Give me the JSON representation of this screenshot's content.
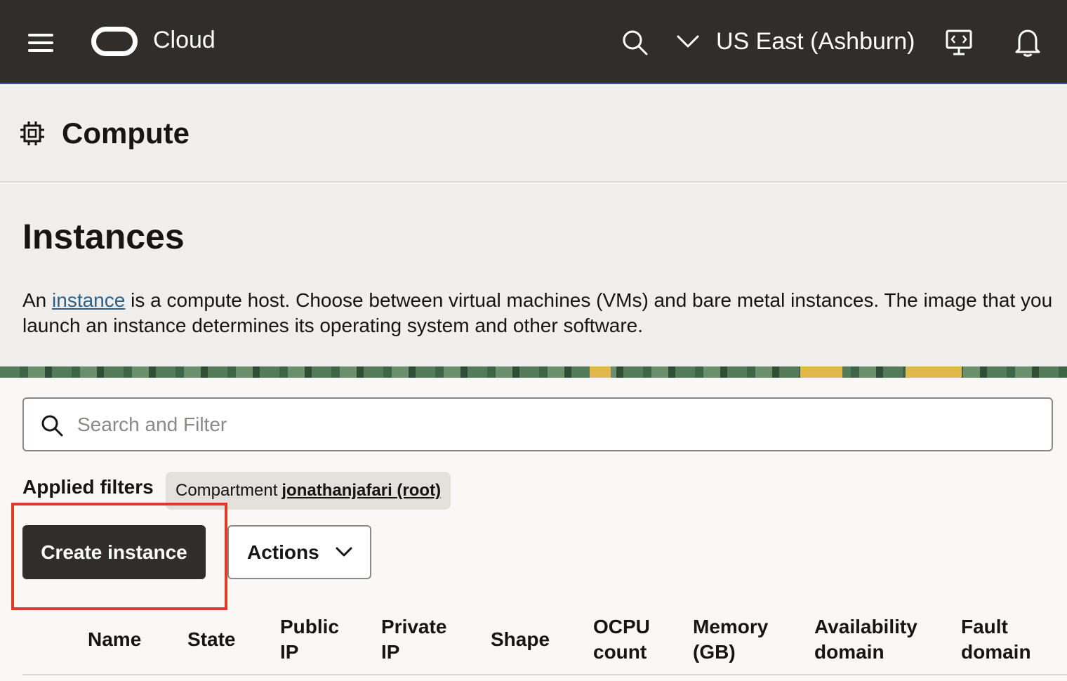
{
  "topbar": {
    "brand": "Cloud",
    "region": "US East (Ashburn)",
    "icons": [
      "hamburger-menu-icon",
      "oracle-logo",
      "search-icon",
      "chevron-down-icon",
      "cloud-shell-icon",
      "bell-icon"
    ]
  },
  "service": {
    "title": "Compute",
    "icon": "chip-icon"
  },
  "page": {
    "title": "Instances",
    "desc_pre": "An ",
    "desc_link": "instance",
    "desc_line1_rest": " is a compute host. Choose between virtual machines (VMs) and bare metal instances. The image that you",
    "desc_line2": "launch an instance determines its operating system and other software."
  },
  "search": {
    "placeholder": "Search and Filter",
    "value": ""
  },
  "filters": {
    "label": "Applied filters",
    "chip_label": "Compartment",
    "chip_value": "jonathanjafari (root)"
  },
  "actions": {
    "create_label": "Create instance",
    "actions_label": "Actions"
  },
  "table": {
    "columns": [
      {
        "l1": "Name",
        "l2": ""
      },
      {
        "l1": "State",
        "l2": ""
      },
      {
        "l1": "Public",
        "l2": "IP"
      },
      {
        "l1": "Private",
        "l2": "IP"
      },
      {
        "l1": "Shape",
        "l2": ""
      },
      {
        "l1": "OCPU",
        "l2": "count"
      },
      {
        "l1": "Memory",
        "l2": "(GB)"
      },
      {
        "l1": "Availability",
        "l2": "domain"
      },
      {
        "l1": "Fault",
        "l2": "domain"
      }
    ]
  },
  "colors": {
    "topbar_bg": "#312d2a",
    "header_bg": "#f1efed",
    "primary_button": "#312d2a",
    "link": "#2c5f87",
    "highlight": "#e0392b"
  }
}
